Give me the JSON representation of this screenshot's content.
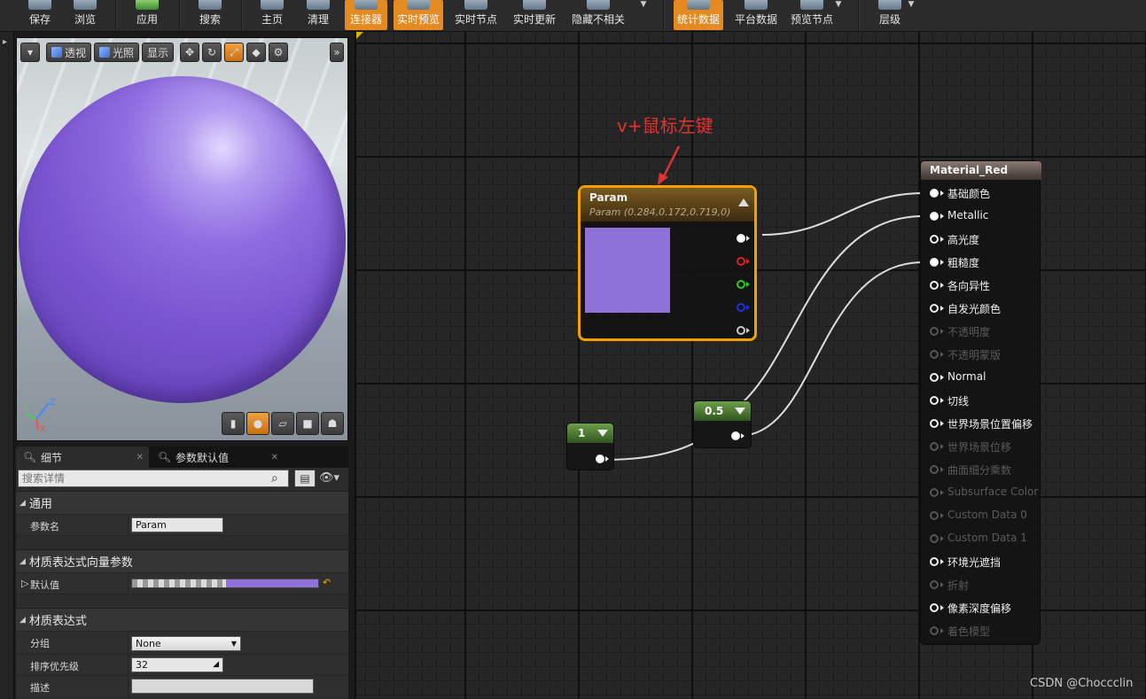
{
  "toolbar": {
    "buttons": [
      {
        "label": "保存"
      },
      {
        "label": "浏览"
      },
      {
        "label": "应用"
      },
      {
        "label": "搜索"
      },
      {
        "label": "主页"
      },
      {
        "label": "清理"
      },
      {
        "label": "连接器"
      },
      {
        "label": "实时预览"
      },
      {
        "label": "实时节点"
      },
      {
        "label": "实时更新"
      },
      {
        "label": "隐藏不相关"
      },
      {
        "label": "统计数据"
      },
      {
        "label": "平台数据"
      },
      {
        "label": "预览节点"
      },
      {
        "label": "层级"
      }
    ],
    "active_color": "#e48a21"
  },
  "viewport": {
    "perspective_label": "透视",
    "lit_label": "光照",
    "show_label": "显示",
    "sphere_color": "#7a55d0",
    "axis": {
      "z": "Z",
      "y": "Y",
      "x": "X"
    }
  },
  "details": {
    "tabs": [
      {
        "label": "细节"
      },
      {
        "label": "参数默认值"
      }
    ],
    "search_placeholder": "搜索详情",
    "categories": {
      "general": "通用",
      "vector_param": "材质表达式向量参数",
      "expression": "材质表达式"
    },
    "props": {
      "param_name_label": "参数名",
      "param_name_value": "Param",
      "default_label": "默认值",
      "group_label": "分组",
      "group_value": "None",
      "priority_label": "排序优先级",
      "priority_value": "32",
      "desc_label": "描述",
      "desc_value": ""
    },
    "default_color": "#8f72d8"
  },
  "graph": {
    "annotation": "v+鼠标左键",
    "param_node": {
      "title": "Param",
      "subtitle": "Param (0.284,0.172,0.719,0)",
      "preview_color": "#8f72d8"
    },
    "const_one": {
      "value": "1"
    },
    "const_half": {
      "value": "0.5"
    },
    "material_node": {
      "title": "Material_Red",
      "inputs": [
        {
          "label": "基础颜色",
          "enabled": true,
          "connected": true
        },
        {
          "label": "Metallic",
          "enabled": true,
          "connected": true
        },
        {
          "label": "高光度",
          "enabled": true,
          "connected": false
        },
        {
          "label": "粗糙度",
          "enabled": true,
          "connected": true
        },
        {
          "label": "各向异性",
          "enabled": true,
          "connected": false
        },
        {
          "label": "自发光颜色",
          "enabled": true,
          "connected": false
        },
        {
          "label": "不透明度",
          "enabled": false,
          "connected": false
        },
        {
          "label": "不透明蒙版",
          "enabled": false,
          "connected": false
        },
        {
          "label": "Normal",
          "enabled": true,
          "connected": false
        },
        {
          "label": "切线",
          "enabled": true,
          "connected": false
        },
        {
          "label": "世界场景位置偏移",
          "enabled": true,
          "connected": false
        },
        {
          "label": "世界场景位移",
          "enabled": false,
          "connected": false
        },
        {
          "label": "曲面细分乘数",
          "enabled": false,
          "connected": false
        },
        {
          "label": "Subsurface Color",
          "enabled": false,
          "connected": false
        },
        {
          "label": "Custom Data 0",
          "enabled": false,
          "connected": false
        },
        {
          "label": "Custom Data 1",
          "enabled": false,
          "connected": false
        },
        {
          "label": "环境光遮挡",
          "enabled": true,
          "connected": false
        },
        {
          "label": "折射",
          "enabled": false,
          "connected": false
        },
        {
          "label": "像素深度偏移",
          "enabled": true,
          "connected": false
        },
        {
          "label": "着色模型",
          "enabled": false,
          "connected": false
        }
      ]
    },
    "watermark": "CSDN @Choccclin"
  }
}
